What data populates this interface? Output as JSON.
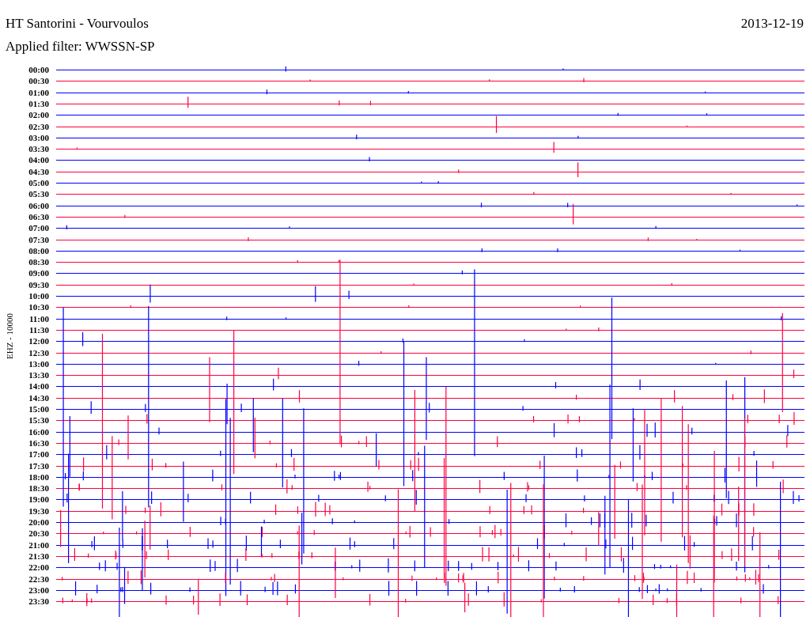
{
  "header": {
    "title": "HT Santorini - Vourvoulos",
    "date": "2013-12-19",
    "filter": "Applied filter: WWSSN-SP"
  },
  "plot": {
    "axis_label": "EHZ - 10000",
    "rows": [
      {
        "time": "00:00",
        "color": "#0000ff"
      },
      {
        "time": "00:30",
        "color": "#ff0040"
      },
      {
        "time": "01:00",
        "color": "#0000ff"
      },
      {
        "time": "01:30",
        "color": "#ff0040"
      },
      {
        "time": "02:00",
        "color": "#0000ff"
      },
      {
        "time": "02:30",
        "color": "#ff0040"
      },
      {
        "time": "03:00",
        "color": "#0000ff"
      },
      {
        "time": "03:30",
        "color": "#ff0040"
      },
      {
        "time": "04:00",
        "color": "#0000ff"
      },
      {
        "time": "04:30",
        "color": "#ff0040"
      },
      {
        "time": "05:00",
        "color": "#0000ff"
      },
      {
        "time": "05:30",
        "color": "#ff0040"
      },
      {
        "time": "06:00",
        "color": "#0000ff"
      },
      {
        "time": "06:30",
        "color": "#ff0040"
      },
      {
        "time": "07:00",
        "color": "#0000ff"
      },
      {
        "time": "07:30",
        "color": "#ff0040"
      },
      {
        "time": "08:00",
        "color": "#0000ff"
      },
      {
        "time": "08:30",
        "color": "#ff0040"
      },
      {
        "time": "09:00",
        "color": "#0000ff"
      },
      {
        "time": "09:30",
        "color": "#ff0040"
      },
      {
        "time": "10:00",
        "color": "#0000ff"
      },
      {
        "time": "10:30",
        "color": "#ff0040"
      },
      {
        "time": "11:00",
        "color": "#0000ff"
      },
      {
        "time": "11:30",
        "color": "#ff0040"
      },
      {
        "time": "12:00",
        "color": "#0000ff"
      },
      {
        "time": "12:30",
        "color": "#ff0040"
      },
      {
        "time": "13:00",
        "color": "#0000ff"
      },
      {
        "time": "13:30",
        "color": "#ff0040"
      },
      {
        "time": "14:00",
        "color": "#0000ff"
      },
      {
        "time": "14:30",
        "color": "#ff0040"
      },
      {
        "time": "15:00",
        "color": "#0000ff"
      },
      {
        "time": "15:30",
        "color": "#ff0040"
      },
      {
        "time": "16:00",
        "color": "#0000ff"
      },
      {
        "time": "16:30",
        "color": "#ff0040"
      },
      {
        "time": "17:00",
        "color": "#0000ff"
      },
      {
        "time": "17:30",
        "color": "#ff0040"
      },
      {
        "time": "18:00",
        "color": "#0000ff"
      },
      {
        "time": "18:30",
        "color": "#ff0040"
      },
      {
        "time": "19:00",
        "color": "#0000ff"
      },
      {
        "time": "19:30",
        "color": "#ff0040"
      },
      {
        "time": "20:00",
        "color": "#0000ff"
      },
      {
        "time": "20:30",
        "color": "#ff0040"
      },
      {
        "time": "21:00",
        "color": "#0000ff"
      },
      {
        "time": "21:30",
        "color": "#ff0040"
      },
      {
        "time": "22:00",
        "color": "#0000ff"
      },
      {
        "time": "22:30",
        "color": "#ff0040"
      },
      {
        "time": "23:00",
        "color": "#0000ff"
      },
      {
        "time": "23:30",
        "color": "#ff0040"
      }
    ]
  }
}
